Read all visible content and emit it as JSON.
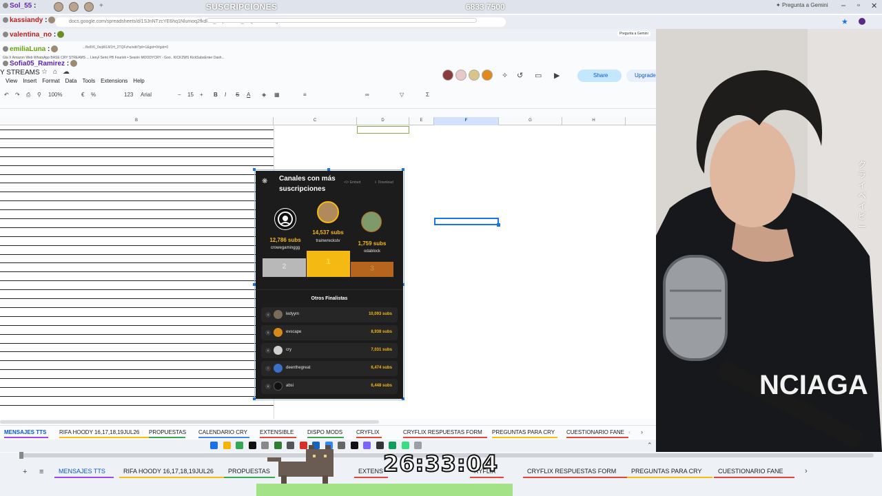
{
  "stream": {
    "title": "SUSCRIPCIONES",
    "counter": "6833 7500",
    "gemini_label": "Pregunta a Gemini",
    "gemini_pill": "Pregunta a Gemini"
  },
  "browser": {
    "url": "docs.google.com/spreadsheets/d/1SJnNTzcYE6hq1Nlumoq2fkdlV6_0xqWLM1H_2TQFzhs/edit?gid=0",
    "url_row2": "...fkdlV6_0xqWLM1H_2TQFzhs/edit?pli=1&gid=0#gid=0",
    "bookmarks_text": "Gla  X  Amazon  Web WhatsApp  BASE CRY STREAMS  ...  Llenyl Serio  PB Fourish • Sesión  MOODYCRY - Goo..  KICK2WS  KickSubsEnter Dash..."
  },
  "chat": [
    {
      "user": "Sol_55",
      "msg": ""
    },
    {
      "user": "kassiandy",
      "msg": ""
    },
    {
      "user": "valentina_no",
      "msg": ""
    },
    {
      "user": "emiliaLuna",
      "msg": ""
    },
    {
      "user": "Sofia05_Ramirez",
      "msg": ""
    }
  ],
  "sheet": {
    "doc_title": "Y STREAMS",
    "menu": [
      "View",
      "Insert",
      "Format",
      "Data",
      "Tools",
      "Extensions",
      "Help"
    ],
    "zoom": "100%",
    "font": "Arial",
    "font_size": "15",
    "share_label": "Share",
    "upgrade_label": "Upgrade",
    "columns": [
      "B",
      "C",
      "D",
      "E",
      "F",
      "G",
      "H"
    ],
    "active_column": "F",
    "tabs": [
      {
        "label": "MENSAJES TTS",
        "active": true,
        "color": "#a142f4"
      },
      {
        "label": "RIFA HOODY 16,17,18,19JUL26",
        "active": false,
        "color": "#fbbc04"
      },
      {
        "label": "PROPUESTAS",
        "active": false,
        "color": "#34a853"
      },
      {
        "label": "CALENDARIO CRY",
        "active": false,
        "color": "#4285f4"
      },
      {
        "label": "EXTENSIBLE",
        "active": false,
        "color": "#ea4335"
      },
      {
        "label": "DISPO MODS",
        "active": false,
        "color": "#34a853"
      },
      {
        "label": "CRYFLIX",
        "active": false,
        "color": "#ea4335"
      },
      {
        "label": "CRYFLIX RESPUESTAS FORM",
        "active": false,
        "color": "#ea4335"
      },
      {
        "label": "PREGUNTAS PARA CRY",
        "active": false,
        "color": "#fbbc04"
      },
      {
        "label": "CUESTIONARIO FANE",
        "active": false,
        "color": "#ea4335"
      }
    ]
  },
  "leaderboard": {
    "title": "Canales con más suscripciones",
    "embed_label": "Embed",
    "download_label": "Download",
    "podium": [
      {
        "rank": "2",
        "name": "crowegaminggg",
        "subs": "12,786 subs"
      },
      {
        "rank": "1",
        "name": "trainwreckstv",
        "subs": "14,537 subs"
      },
      {
        "rank": "3",
        "name": "odablock",
        "subs": "1,759 subs"
      }
    ],
    "others_title": "Otros Finalistas",
    "finalists": [
      {
        "rank": "4",
        "name": "ledyym",
        "subs": "10,093 subs"
      },
      {
        "rank": "5",
        "name": "evscape",
        "subs": "8,938 subs"
      },
      {
        "rank": "6",
        "name": "cry",
        "subs": "7,031 subs"
      },
      {
        "rank": "7",
        "name": "deenthegreat",
        "subs": "6,474 subs"
      },
      {
        "rank": "8",
        "name": "absi",
        "subs": "6,448 subs"
      }
    ]
  },
  "overlay": {
    "timer": "26:33:04",
    "katakana": "クライベイビー"
  },
  "bottom_tabs": [
    {
      "label": "MENSAJES TTS",
      "active": true
    },
    {
      "label": "RIFA HOODY 16,17,18,19JUL26",
      "active": false
    },
    {
      "label": "PROPUESTAS",
      "active": false
    },
    {
      "label": "EXTENS",
      "active": false
    },
    {
      "label": "RYFLIX",
      "active": false
    },
    {
      "label": "CRYFLIX RESPUESTAS FORM",
      "active": false
    },
    {
      "label": "PREGUNTAS PARA CRY",
      "active": false
    },
    {
      "label": "CUESTIONARIO FANE",
      "active": false
    }
  ],
  "colors": {
    "accent": "#1a73e8",
    "gold": "#f5b914",
    "silver": "#b8b8b8",
    "bronze": "#b5651d",
    "card_bg": "#1c1c1c"
  }
}
